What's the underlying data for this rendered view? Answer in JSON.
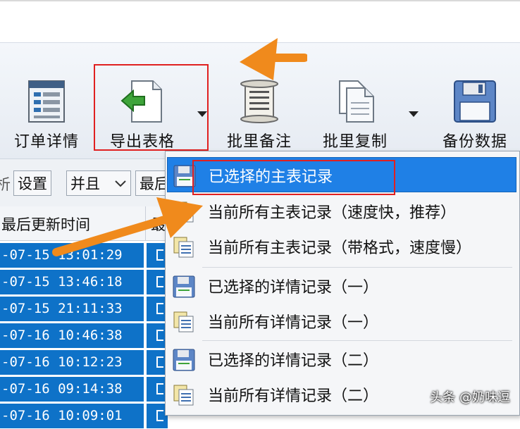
{
  "toolbar": {
    "buttons": [
      {
        "label": "订单详情",
        "icon": "order-details-icon"
      },
      {
        "label": "导出表格",
        "icon": "export-table-icon"
      },
      {
        "label": "批里备注",
        "icon": "batch-note-icon"
      },
      {
        "label": "批里复制",
        "icon": "batch-copy-icon"
      },
      {
        "label": "备份数据",
        "icon": "backup-data-icon"
      }
    ]
  },
  "filterbar": {
    "left_glyph": "析",
    "settings_label": "设置",
    "logic_select": "并且",
    "field_select_partial": "最后"
  },
  "grid": {
    "header_col1": "最后更新时间",
    "header_col2_partial": "最",
    "rows": [
      "-07-15 13:01:29",
      "-07-15 13:46:18",
      "-07-15 21:11:33",
      "-07-16 10:46:38",
      "-07-16 10:12:23",
      "-07-16 09:14:38",
      "-07-16 10:09:01"
    ]
  },
  "export_menu": {
    "items": [
      {
        "label": "已选择的主表记录",
        "icon": "floppy-disk-icon",
        "selected": true
      },
      {
        "label": "当前所有主表记录（速度快，推荐）",
        "icon": "copy-pages-icon",
        "selected": false
      },
      {
        "label": "当前所有主表记录（带格式，速度慢）",
        "icon": "copy-pages-icon",
        "selected": false
      },
      {
        "label": "已选择的详情记录（一）",
        "icon": "floppy-disk-icon",
        "selected": false
      },
      {
        "label": "当前所有详情记录（一）",
        "icon": "copy-pages-icon",
        "selected": false
      },
      {
        "label": "已选择的详情记录（二）",
        "icon": "floppy-disk-icon",
        "selected": false
      },
      {
        "label": "当前所有详情记录（二）",
        "icon": "copy-pages-icon",
        "selected": false
      }
    ]
  },
  "watermark": "头条 @奶味逗",
  "colors": {
    "selection_blue": "#1f80e6",
    "row_blue": "#0e72c8",
    "highlight_red": "#e02020",
    "annotation_orange": "#f08a1c"
  }
}
